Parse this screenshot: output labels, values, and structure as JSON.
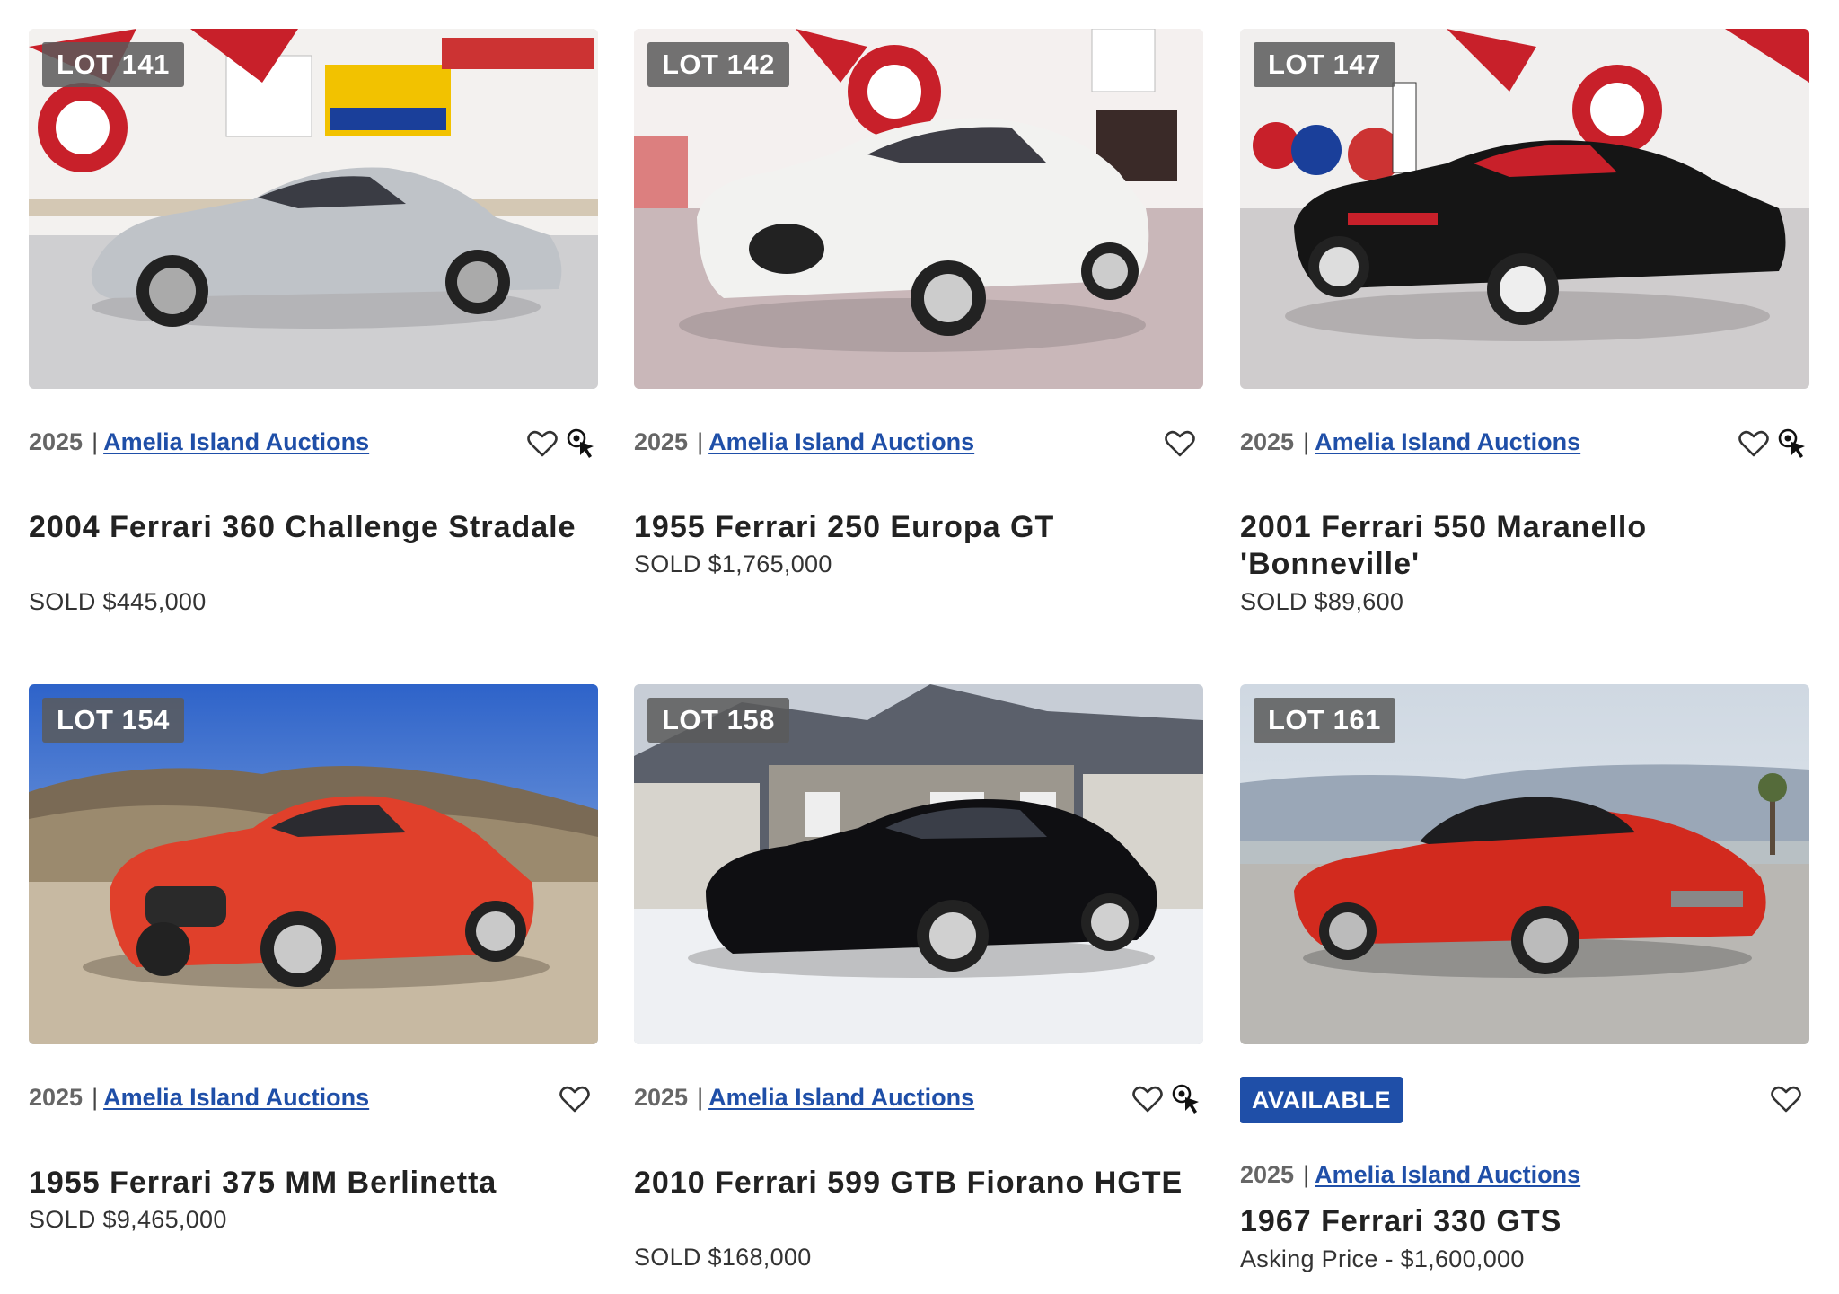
{
  "listings": [
    {
      "lot": "LOT 141",
      "year": "2025",
      "separator": "|",
      "auction": "Amelia Island Auctions",
      "title": "2004 Ferrari 360 Challenge Stradale",
      "price": "SOLD $445,000",
      "compare_icon": "compare-cursor-icon"
    },
    {
      "lot": "LOT 142",
      "year": "2025",
      "separator": "|",
      "auction": "Amelia Island Auctions",
      "title": "1955 Ferrari 250 Europa GT",
      "price": "SOLD $1,765,000"
    },
    {
      "lot": "LOT 147",
      "year": "2025",
      "separator": "|",
      "auction": "Amelia Island Auctions",
      "title": "2001 Ferrari 550 Maranello 'Bonneville'",
      "price": "SOLD $89,600",
      "compare_icon": "compare-cursor-icon"
    },
    {
      "lot": "LOT 154",
      "year": "2025",
      "separator": "|",
      "auction": "Amelia Island Auctions",
      "title": "1955 Ferrari 375 MM Berlinetta",
      "price": "SOLD $9,465,000"
    },
    {
      "lot": "LOT 158",
      "year": "2025",
      "separator": "|",
      "auction": "Amelia Island Auctions",
      "title": "2010 Ferrari 599 GTB Fiorano HGTE",
      "price": "SOLD $168,000",
      "compare_icon": "compare-cursor-icon"
    },
    {
      "lot": "LOT 161",
      "status": "AVAILABLE",
      "year": "2025",
      "separator": "|",
      "auction": "Amelia Island Auctions",
      "title": "1967 Ferrari 330 GTS",
      "price": "Asking Price - $1,600,000"
    }
  ],
  "colors": {
    "link": "#1f4fa8",
    "available_badge": "#1f4fa8",
    "lot_badge": "#5a5a5a"
  },
  "photos": [
    {
      "car_color": "#bfc3c8"
    },
    {
      "car_color": "#f2f2f0"
    },
    {
      "car_color": "#151515"
    },
    {
      "car_color": "#e0402b"
    },
    {
      "car_color": "#0f0f12"
    },
    {
      "car_color": "#d22a1e"
    }
  ]
}
